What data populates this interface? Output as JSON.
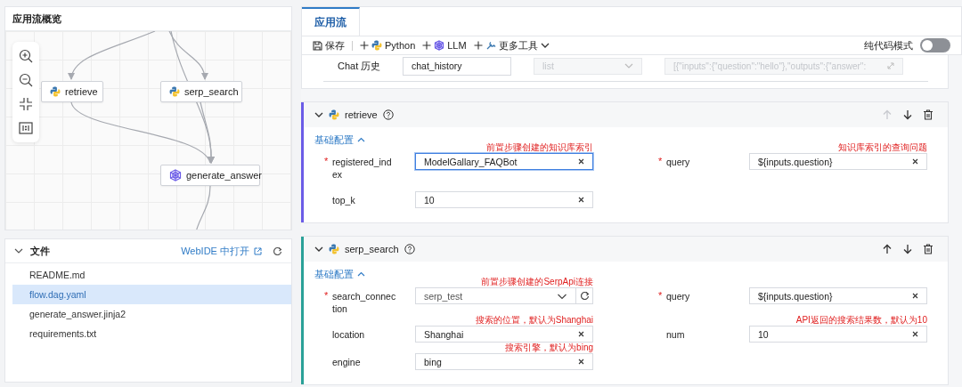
{
  "overview": {
    "title": "应用流概览",
    "nodes": [
      {
        "label": "retrieve",
        "kind": "python"
      },
      {
        "label": "serp_search",
        "kind": "python"
      },
      {
        "label": "generate_answer",
        "kind": "llm"
      }
    ]
  },
  "files": {
    "title": "文件",
    "open_link": "WebIDE 中打开",
    "items": [
      {
        "name": "README.md",
        "selected": false
      },
      {
        "name": "flow.dag.yaml",
        "selected": true
      },
      {
        "name": "generate_answer.jinja2",
        "selected": false
      },
      {
        "name": "requirements.txt",
        "selected": false
      }
    ]
  },
  "tabs": [
    {
      "label": "应用流",
      "selected": true
    }
  ],
  "toolbar": {
    "save": "保存",
    "add": [
      {
        "label": "Python",
        "kind": "python"
      },
      {
        "label": "LLM",
        "kind": "llm"
      },
      {
        "label": "更多工具",
        "kind": "tools"
      }
    ],
    "code_mode": {
      "label": "纯代码模式",
      "on": false
    }
  },
  "chat_history": {
    "label": "Chat 历史",
    "name": "chat_history",
    "type": "list",
    "value": "[{\"inputs\":{\"question\":\"hello\"},\"outputs\":{\"answer\":"
  },
  "steps": [
    {
      "name": "retrieve",
      "color": "#6b5ce7",
      "up_disabled": true,
      "section": "基础配置",
      "fields": [
        {
          "mark": "*",
          "label": "registered_index",
          "kind": "input",
          "value": "ModelGallary_FAQBot",
          "note": "前置步骤创建的知识库索引",
          "focused": true
        },
        {
          "mark": "*",
          "label": "query",
          "kind": "input",
          "value": "${inputs.question}",
          "note": "知识库索引的查询问题",
          "focused": false
        },
        {
          "label": "top_k",
          "kind": "input",
          "value": "10",
          "focused": false
        }
      ]
    },
    {
      "name": "serp_search",
      "color": "#2aa198",
      "up_disabled": false,
      "section": "基础配置",
      "fields": [
        {
          "mark": "*",
          "label": "search_connection",
          "kind": "select",
          "value": "serp_test",
          "note": "前置步骤创建的SerpApi连接",
          "focused": false
        },
        {
          "mark": "*",
          "label": "query",
          "kind": "input",
          "value": "${inputs.question}",
          "focused": false
        },
        {
          "label": "location",
          "kind": "input",
          "value": "Shanghai",
          "note": "搜索的位置，默认为Shanghai",
          "focused": false
        },
        {
          "label": "num",
          "kind": "input",
          "value": "10",
          "note": "API返回的搜索结果数，默认为10",
          "focused": false
        },
        {
          "label": "engine",
          "kind": "input",
          "value": "bing",
          "note": "搜索引擎，默认为bing",
          "focused": false
        }
      ]
    }
  ]
}
